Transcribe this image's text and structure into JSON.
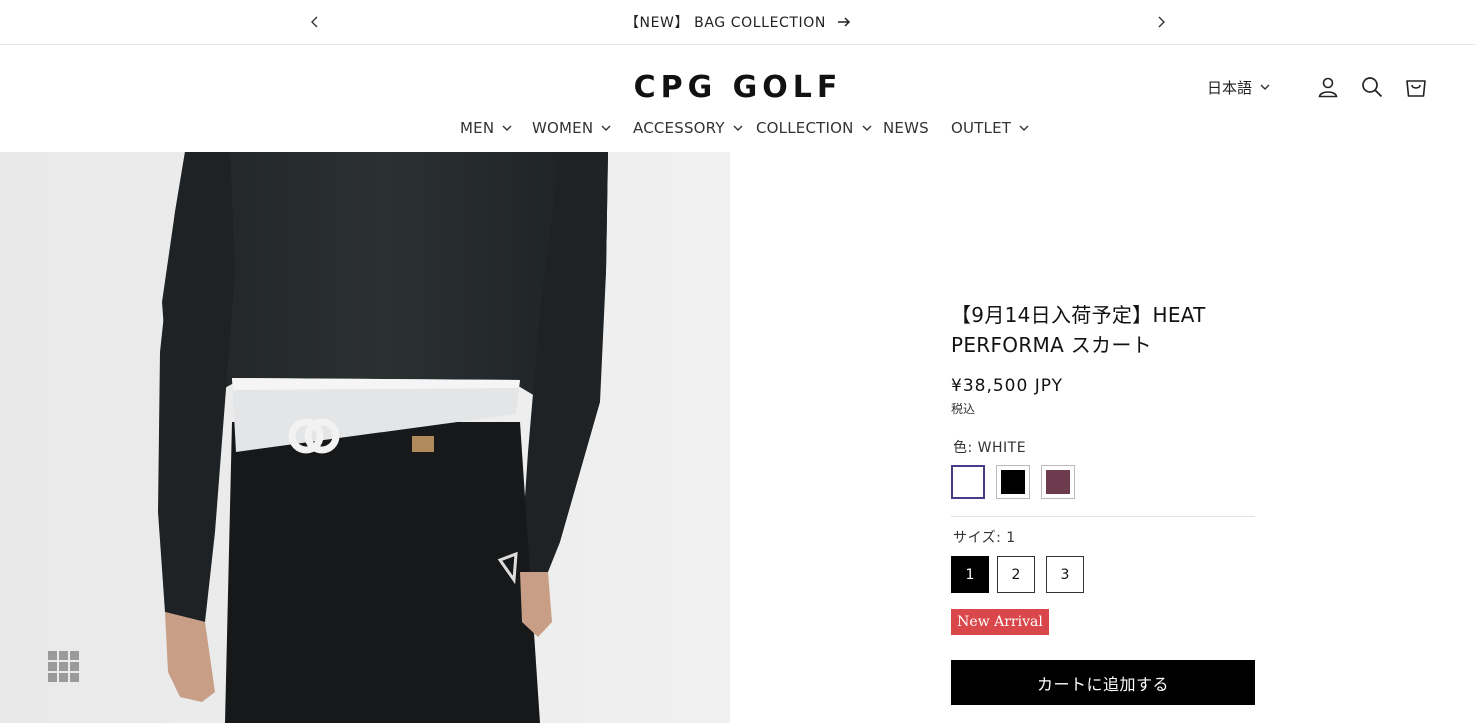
{
  "announcement": {
    "text": "【NEW】 BAG COLLECTION",
    "prev_icon": "chevron-left-icon",
    "next_icon": "chevron-right-icon",
    "arrow_icon": "arrow-right-icon"
  },
  "header": {
    "logo": "CPG GOLF",
    "language": "日本語",
    "icons": [
      "account-icon",
      "search-icon",
      "cart-icon"
    ]
  },
  "nav": {
    "items": [
      {
        "label": "MEN",
        "has_dropdown": true
      },
      {
        "label": "WOMEN",
        "has_dropdown": true
      },
      {
        "label": "ACCESSORY",
        "has_dropdown": true
      },
      {
        "label": "COLLECTION",
        "has_dropdown": true
      },
      {
        "label": "NEWS",
        "has_dropdown": false
      },
      {
        "label": "OUTLET",
        "has_dropdown": true
      }
    ]
  },
  "product": {
    "title": "【9月14日入荷予定】HEAT PERFORMA スカート",
    "price": "¥38,500 JPY",
    "tax_note": "税込",
    "color_label": "色: WHITE",
    "colors": [
      {
        "name": "WHITE",
        "hex": "#ffffff",
        "selected": true
      },
      {
        "name": "BLACK",
        "hex": "#000000",
        "selected": false
      },
      {
        "name": "WINE",
        "hex": "#6e3a4e",
        "selected": false
      }
    ],
    "size_label": "サイズ: 1",
    "sizes": [
      {
        "label": "1",
        "selected": true
      },
      {
        "label": "2",
        "selected": false
      },
      {
        "label": "3",
        "selected": false
      }
    ],
    "badge": "New Arrival",
    "add_to_cart": "カートに追加する"
  },
  "media": {
    "gallery_icon": "grid-icon"
  },
  "colors": {
    "badge": "#d9474a",
    "button": "#000000",
    "selected_swatch_border": "#4b3a88"
  }
}
